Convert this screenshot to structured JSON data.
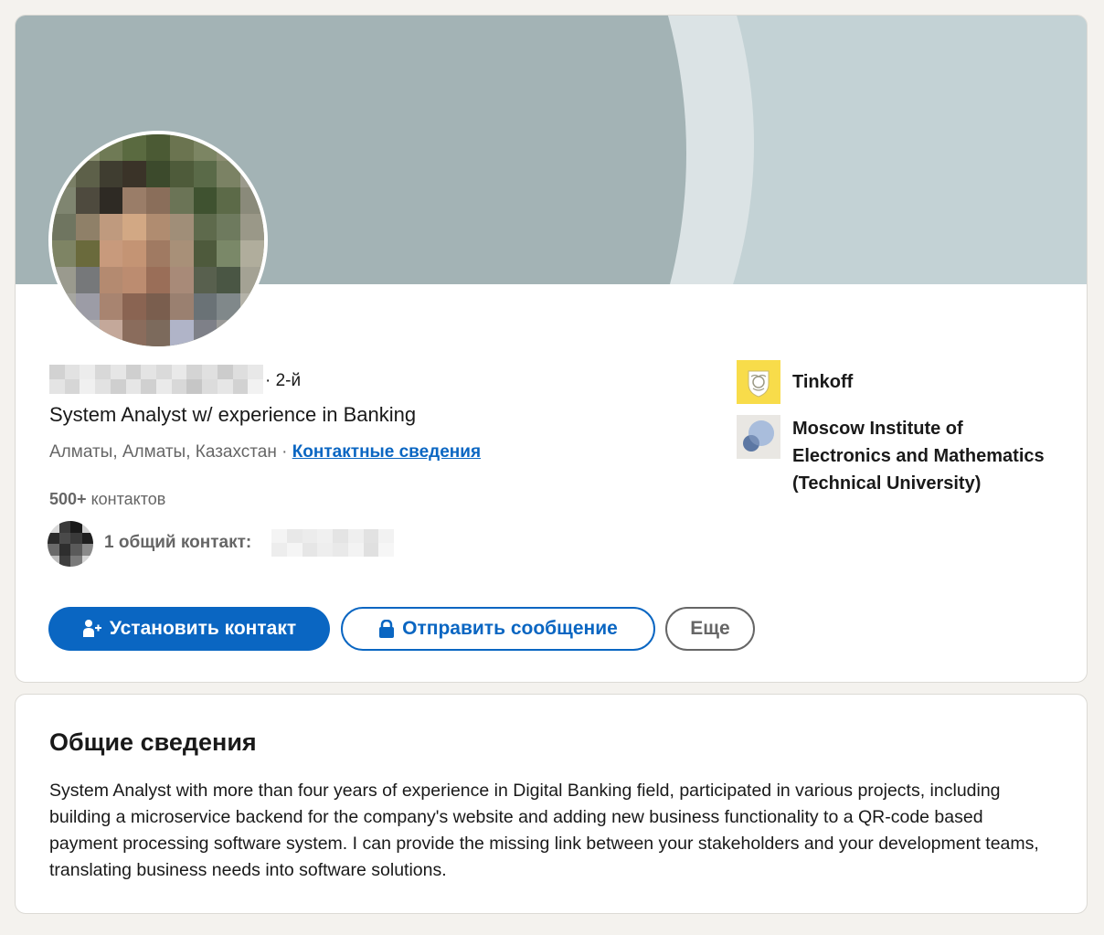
{
  "profile": {
    "degree": "· 2-й",
    "headline": "System Analyst w/ experience in Banking",
    "location": "Алматы, Алматы, Казахстан",
    "separator": "·",
    "contact_info_link": "Контактные сведения",
    "connections_count": "500+",
    "connections_label": "контактов",
    "mutual_text": "1 общий контакт:"
  },
  "actions": {
    "connect_label": "Установить контакт",
    "message_label": "Отправить сообщение",
    "more_label": "Еще",
    "connect_icon": "add-person-icon",
    "message_icon": "lock-icon"
  },
  "organizations": [
    {
      "name": "Tinkoff",
      "logo": "tinkoff-logo"
    },
    {
      "name": "Moscow Institute of Electronics and Mathematics (Technical University)",
      "logo": "miem-logo"
    }
  ],
  "about": {
    "title": "Общие сведения",
    "text": "System Analyst with more than four years of experience in Digital Banking field, participated in various projects, including building a microservice backend for the company's website and adding new business functionality to a QR-code based payment processing software system. I can provide the missing link between your stakeholders and your development teams, translating business needs into software solutions."
  },
  "colors": {
    "accent": "#0a66c2",
    "banner": "#a3b3b5",
    "page_bg": "#f4f2ee"
  }
}
